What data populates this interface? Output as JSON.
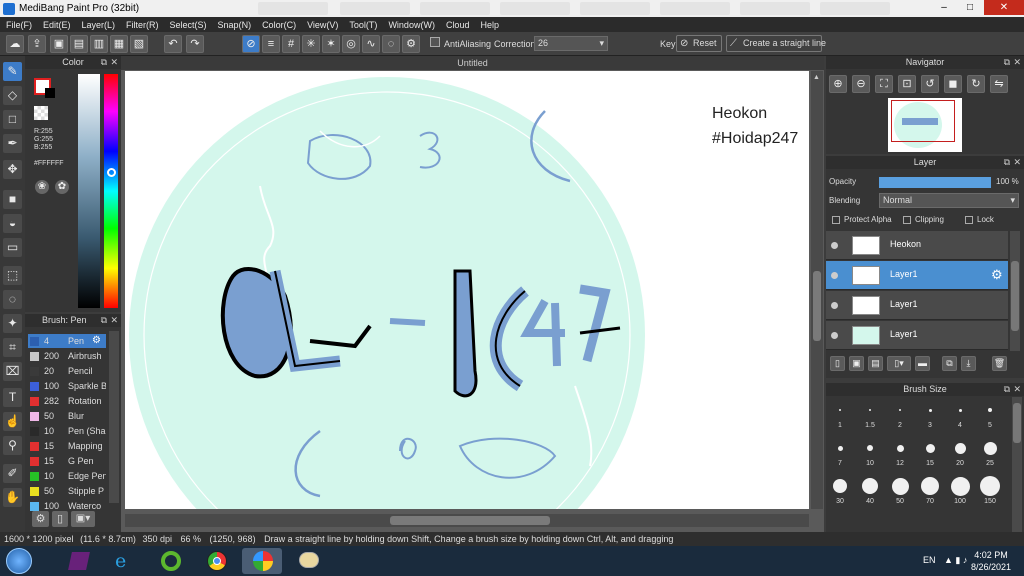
{
  "window": {
    "title": "MediBang Paint Pro (32bit)",
    "controls": {
      "minimize": "–",
      "maximize": "□",
      "close": "✕"
    }
  },
  "menu": [
    "File(F)",
    "Edit(E)",
    "Layer(L)",
    "Filter(R)",
    "Select(S)",
    "Snap(N)",
    "Color(C)",
    "View(V)",
    "Tool(T)",
    "Window(W)",
    "Cloud",
    "Help"
  ],
  "toolbar": {
    "antialiasing_label": "AntiAliasing",
    "correction_label": "Correction",
    "correction_value": "26",
    "key_label": "Key",
    "reset_label": "Reset",
    "straight_line_label": "Create a straight line"
  },
  "color_panel": {
    "title": "Color",
    "r": "R:255",
    "g": "G:255",
    "b": "B:255",
    "hex": "#FFFFFF",
    "foreground": "#ffffff",
    "foreground_border": "#e02020"
  },
  "brush_panel": {
    "title": "Brush: Pen",
    "items": [
      {
        "size": "4",
        "name": "Pen",
        "color": "#2c5fb0",
        "selected": true
      },
      {
        "size": "200",
        "name": "Airbrush",
        "color": "#c8c8c8"
      },
      {
        "size": "20",
        "name": "Pencil",
        "color": "#3a3a3a"
      },
      {
        "size": "100",
        "name": "Sparkle B",
        "color": "#3c5fd8"
      },
      {
        "size": "282",
        "name": "Rotation",
        "color": "#e23030"
      },
      {
        "size": "50",
        "name": "Blur",
        "color": "#f0b8e8"
      },
      {
        "size": "10",
        "name": "Pen (Sha",
        "color": "#2a2a2a"
      },
      {
        "size": "15",
        "name": "Mapping",
        "color": "#e23030"
      },
      {
        "size": "15",
        "name": "G Pen",
        "color": "#e23030"
      },
      {
        "size": "10",
        "name": "Edge Pen",
        "color": "#26c226"
      },
      {
        "size": "50",
        "name": "Stipple P",
        "color": "#e8e020"
      },
      {
        "size": "100",
        "name": "Waterco",
        "color": "#5ab8f0"
      }
    ]
  },
  "canvas": {
    "doc_title": "Untitled",
    "watermark_line1": "Heokon",
    "watermark_line2": "#Hoidap247",
    "circle_color": "#d4f7ec",
    "ink_color": "#7a9fd0"
  },
  "navigator": {
    "title": "Navigator"
  },
  "layer_panel": {
    "title": "Layer",
    "opacity_label": "Opacity",
    "opacity_value": "100 %",
    "opacity_fraction": 1.0,
    "blending_label": "Blending",
    "blending_value": "Normal",
    "protect_alpha_label": "Protect Alpha",
    "clipping_label": "Clipping",
    "lock_label": "Lock",
    "layers": [
      {
        "name": "Heokon",
        "selected": false
      },
      {
        "name": "Layer1",
        "selected": true
      },
      {
        "name": "Layer1",
        "selected": false
      },
      {
        "name": "Layer1",
        "selected": false
      }
    ]
  },
  "brush_size_panel": {
    "title": "Brush Size",
    "sizes": [
      "1",
      "1.5",
      "2",
      "3",
      "4",
      "5",
      "7",
      "10",
      "12",
      "15",
      "20",
      "25",
      "30",
      "40",
      "50",
      "70",
      "100",
      "150"
    ]
  },
  "status": {
    "size": "1600 * 1200 pixel",
    "physical": "(11.6 * 8.7cm)",
    "dpi": "350 dpi",
    "zoom": "66 %",
    "coords": "(1250, 968)",
    "hint": "Draw a straight line by holding down Shift, Change a brush size by holding down Ctrl, Alt, and dragging"
  },
  "taskbar": {
    "lang": "EN",
    "time": "4:02 PM",
    "date": "8/26/2021"
  }
}
